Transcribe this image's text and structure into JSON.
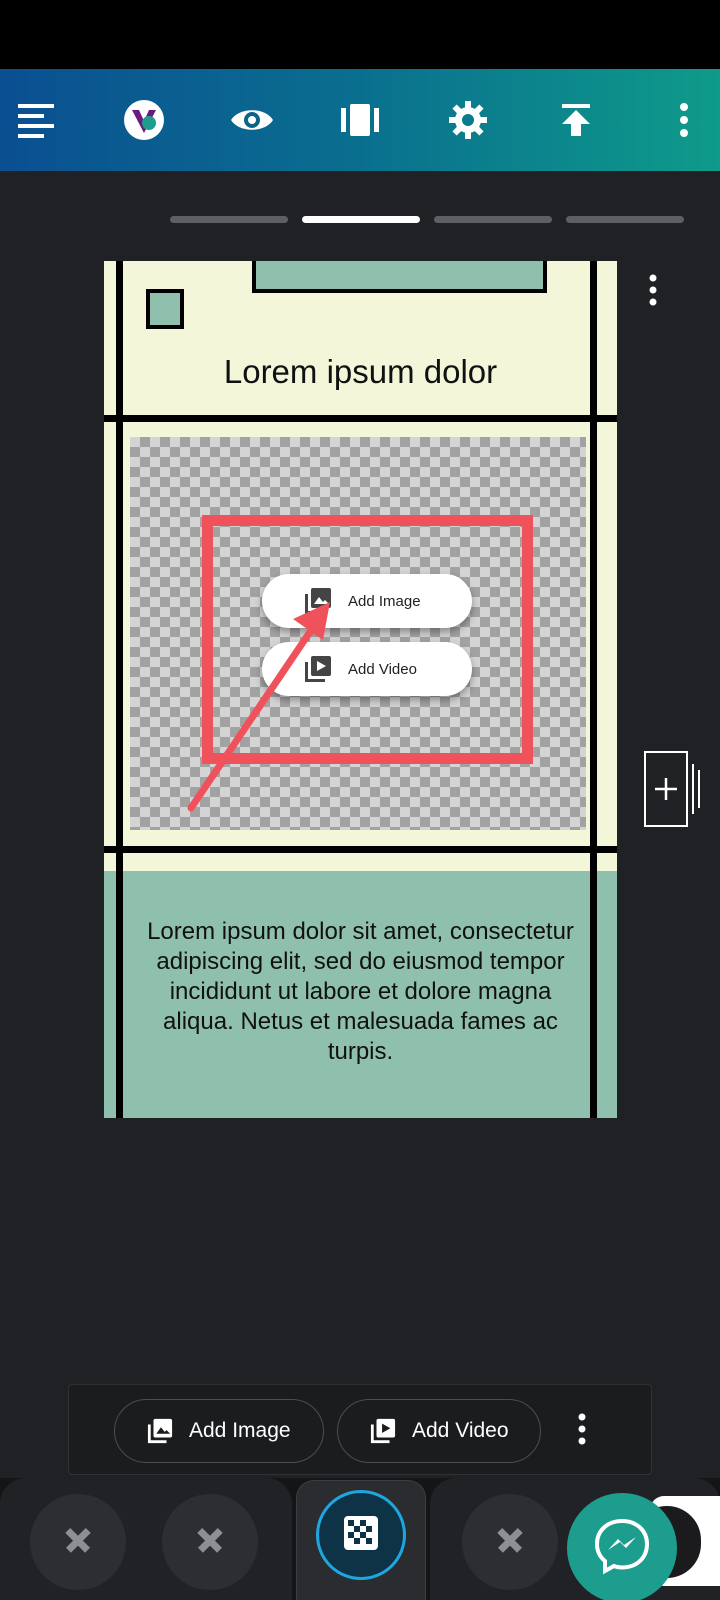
{
  "top_toolbar": {
    "icons": [
      "align-left-icon",
      "app-logo-icon",
      "eye-icon",
      "carousel-icon",
      "gear-icon",
      "upload-icon",
      "more-vert-icon"
    ]
  },
  "page_indicator": {
    "count": 4,
    "active_index": 1
  },
  "card": {
    "title": "Lorem ipsum dolor",
    "body": "Lorem ipsum dolor sit amet, consectetur adipiscing elit, sed do eiusmod tempor incididunt ut labore et dolore magna aliqua. Netus et malesuada fames ac turpis.",
    "add_image_label": "Add Image",
    "add_video_label": "Add Video"
  },
  "bottom_toolbar": {
    "add_image_label": "Add Image",
    "add_video_label": "Add Video"
  },
  "colors": {
    "topbar_start": "#0a4f91",
    "topbar_end": "#0e9b8a",
    "card_cream": "#f3f6d9",
    "card_green": "#8fc0ae",
    "highlight_red": "#f0525c",
    "messenger_teal": "#1c9d8e",
    "center_nav_blue": "#1fa6df"
  }
}
